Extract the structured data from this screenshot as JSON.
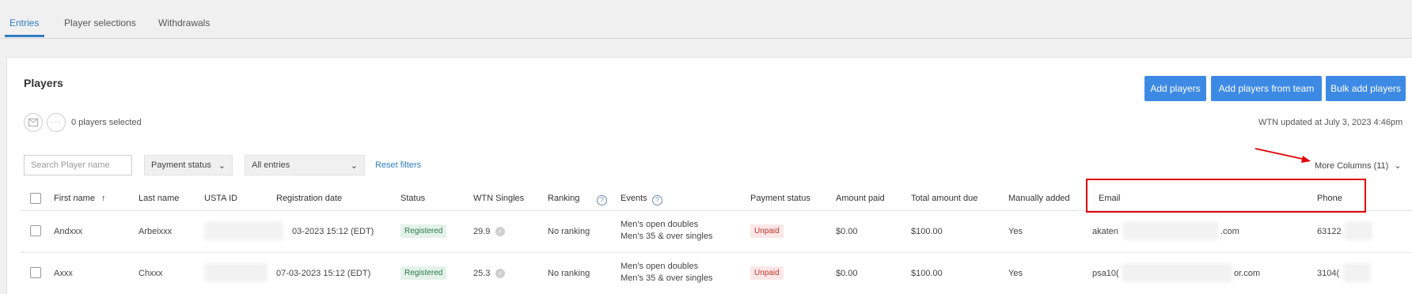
{
  "tabs": [
    {
      "label": "Entries",
      "active": true
    },
    {
      "label": "Player selections",
      "active": false
    },
    {
      "label": "Withdrawals",
      "active": false
    }
  ],
  "panel": {
    "title": "Players",
    "buttons": {
      "add": "Add players",
      "add_team": "Add players from team",
      "bulk": "Bulk add players"
    },
    "selected_text": "0 players selected",
    "wtn_updated": "WTN updated at July 3, 2023 4:46pm",
    "search_placeholder": "Search Player name",
    "payment_filter": "Payment status",
    "entries_filter": "All entries",
    "reset_filters": "Reset filters",
    "more_columns": "More Columns (11)"
  },
  "table": {
    "headers": {
      "first_name": "First name",
      "last_name": "Last name",
      "usta_id": "USTA ID",
      "registration_date": "Registration date",
      "status": "Status",
      "wtn_singles": "WTN Singles",
      "ranking": "Ranking",
      "events": "Events",
      "payment_status": "Payment status",
      "amount_paid": "Amount paid",
      "total_due": "Total amount due",
      "manually_added": "Manually added",
      "email": "Email",
      "phone": "Phone"
    },
    "rows": [
      {
        "first_name": "Andxxx",
        "last_name": "Arbeixxx",
        "registration_date": "03-2023 15:12 (EDT)",
        "status": "Registered",
        "wtn": "29.9",
        "ranking": "No ranking",
        "event1": "Men's open doubles",
        "event2": "Men's 35 & over singles",
        "payment_status": "Unpaid",
        "amount_paid": "$0.00",
        "total_due": "$100.00",
        "manually_added": "Yes",
        "email_start": "akaten",
        "email_end": ".com",
        "phone": "63122"
      },
      {
        "first_name": "Axxx",
        "last_name": "Chxxx",
        "registration_date": "07-03-2023 15:12 (EDT)",
        "status": "Registered",
        "wtn": "25.3",
        "ranking": "No ranking",
        "event1": "Men's open doubles",
        "event2": "Men's 35 & over singles",
        "payment_status": "Unpaid",
        "amount_paid": "$0.00",
        "total_due": "$100.00",
        "manually_added": "Yes",
        "email_start": "psa10(",
        "email_end": "or.com",
        "phone": "3104("
      }
    ]
  },
  "colors": {
    "accent": "#3d8ae5",
    "link": "#2f7fc4",
    "annotation": "#e00000"
  }
}
